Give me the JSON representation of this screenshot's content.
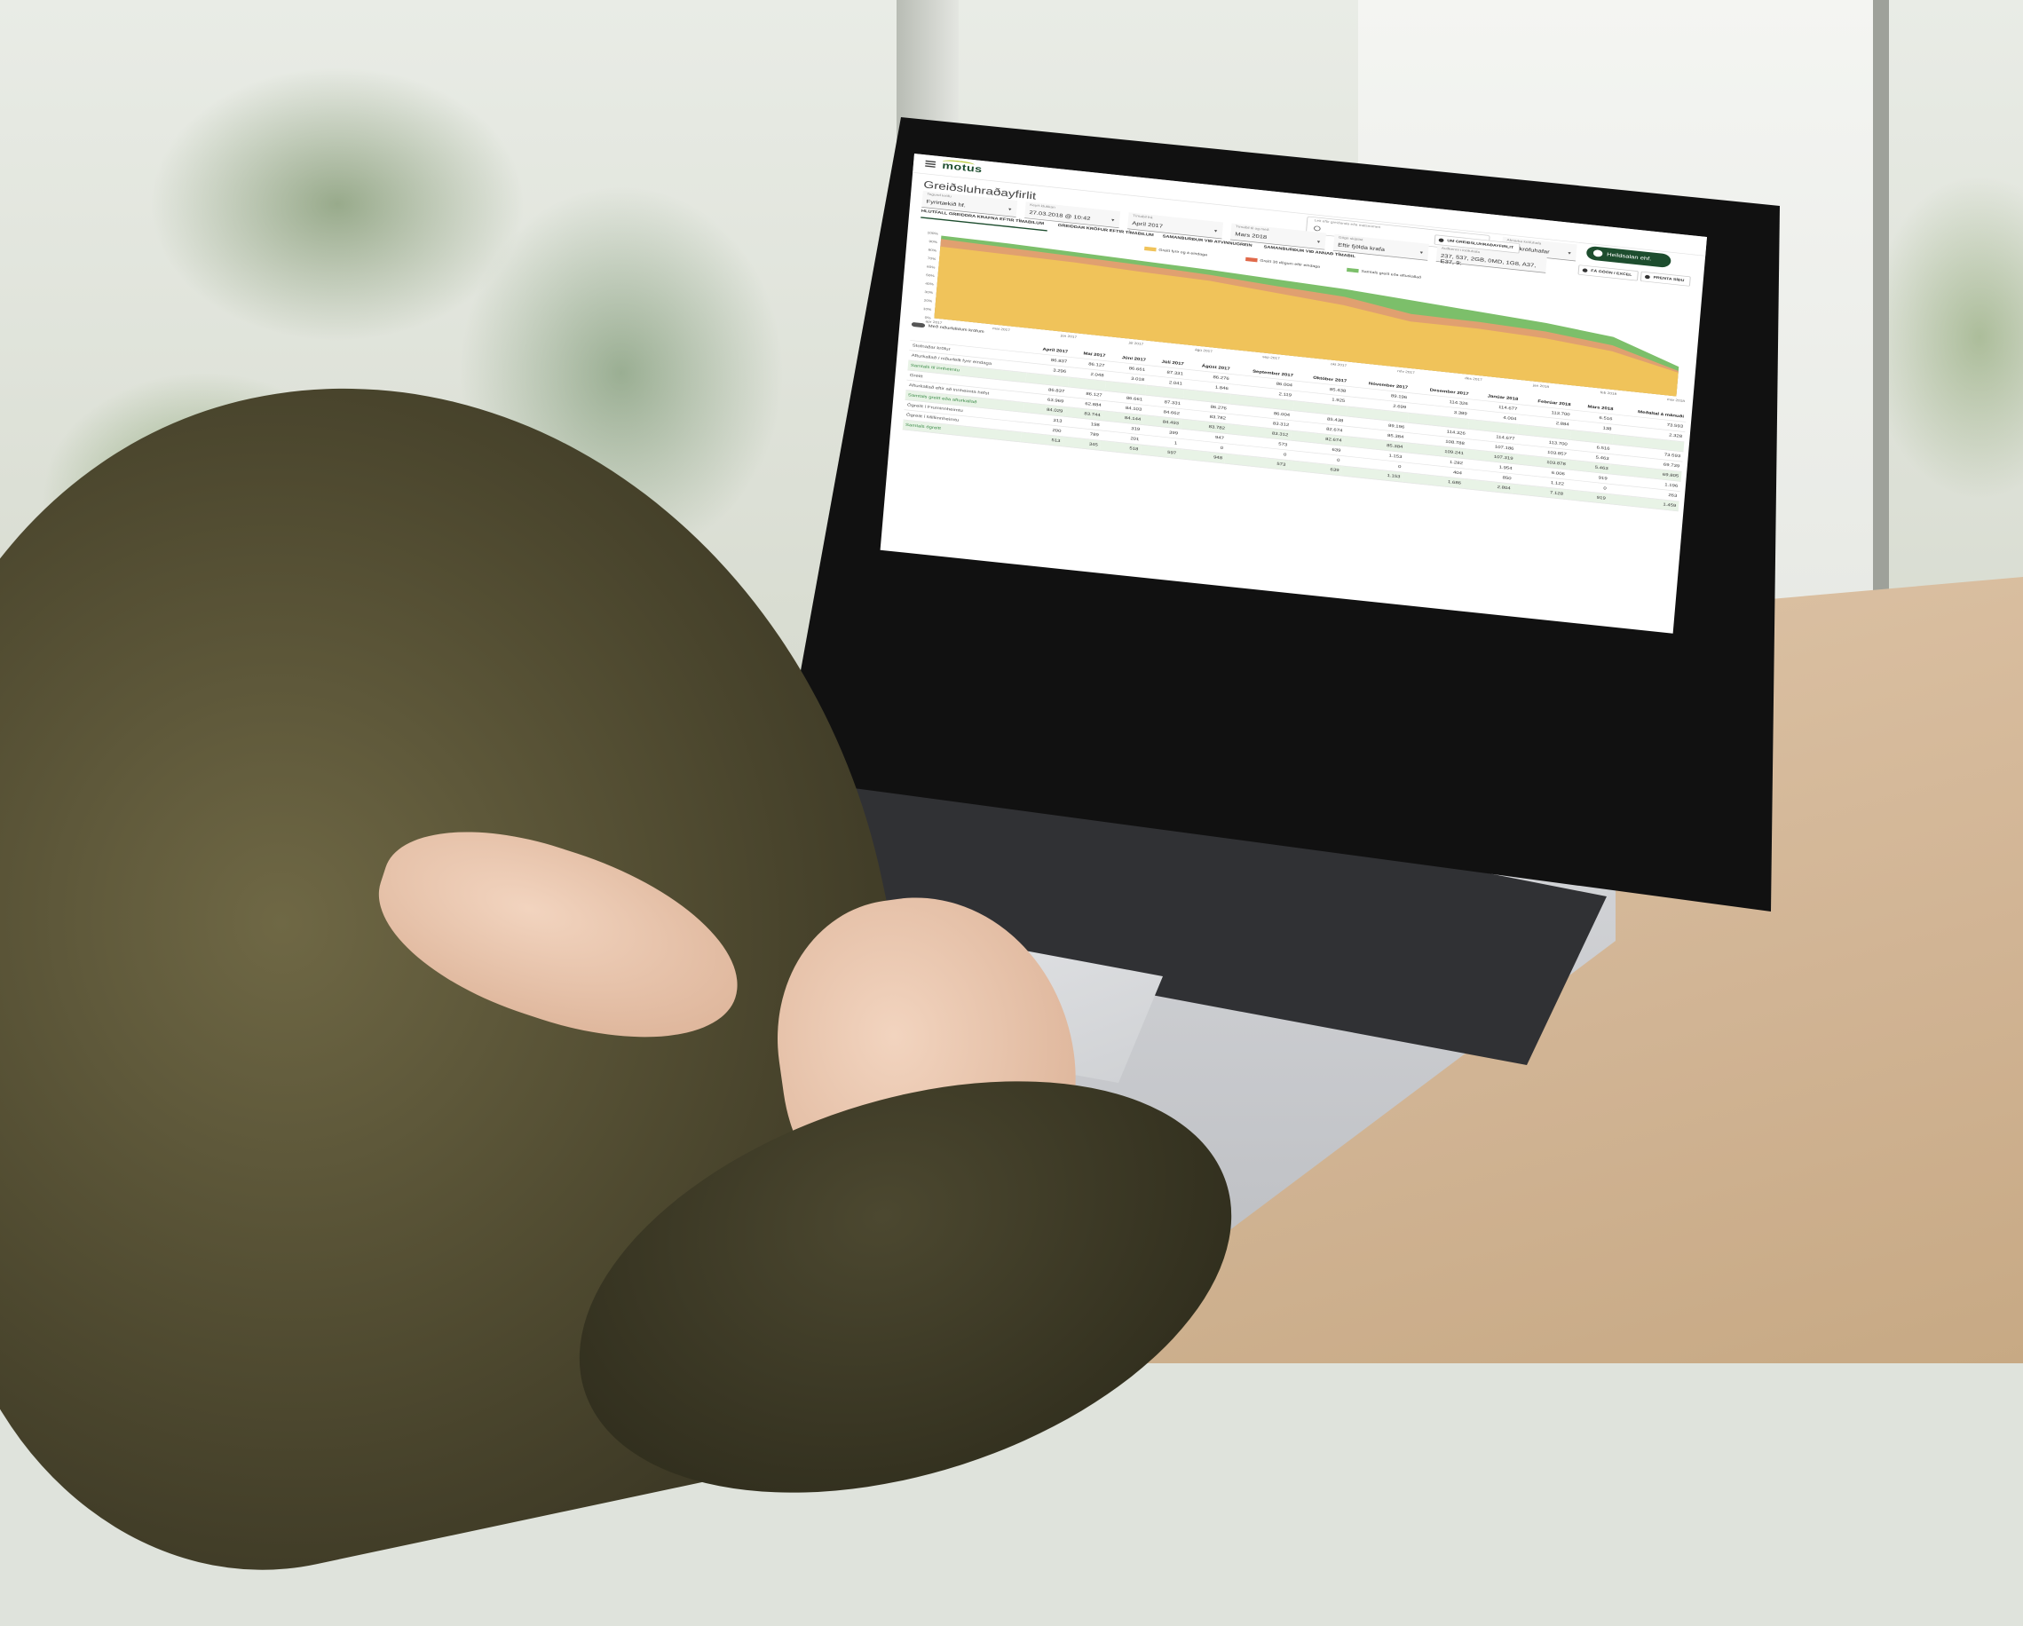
{
  "app": {
    "logo": "motus",
    "page_title": "Greiðsluhraðayfirlit",
    "search_placeholder": "Leit eftir greiðanda eða málsnúmeri",
    "user_button": "Heildsalan ehf."
  },
  "filters": [
    {
      "label": "Tegund kröfu",
      "value": "Fyrirtækið hf."
    },
    {
      "label": "Keyrt klukkan",
      "value": "27.03.2018 @ 10:42"
    },
    {
      "label": "Tímabil frá",
      "value": "Apríl 2017"
    },
    {
      "label": "Tímabil til og með",
      "value": "Mars 2018"
    },
    {
      "label": "Gögn skiptist",
      "value": "Eftir fjölda krafa"
    },
    {
      "label": "Auðkenni i kröfuhafa",
      "value": "237, 537, 2GB, 0MD, 1G8, A37, E37, 9:"
    },
    {
      "label": "Afmarka kröfuhafa",
      "value": "Allir kröfuhafar"
    }
  ],
  "actions": [
    "UM GREIÐSLUHRAÐAYFIRLIT",
    "FÁ GÖGN í EXCEL",
    "PRENTA SÍÐU"
  ],
  "tabs": [
    "HLUTFALL GREIDDRA KRAFNA EFTIR TÍMABILUM",
    "GREIDDAR KRÖFUR EFTIR TÍMABILUM",
    "SAMANBURÐUR VIÐ ATVINNUGREIN",
    "SAMANBURÐUR VIÐ ANNAÐ TÍMABIL"
  ],
  "chart_data": {
    "type": "area",
    "legend": [
      "Greitt fyrir og á eindaga",
      "Greitt 30 dögum eftir eindaga",
      "Samtals greitt eða afturkallað"
    ],
    "colors": {
      "paid_on_time": "#f0c35a",
      "paid_30": "#e0a070",
      "total": "#7cbf6a"
    },
    "x": [
      "apr 2017",
      "maí 2017",
      "jún 2017",
      "júl 2017",
      "ágú 2017",
      "sep 2017",
      "okt 2017",
      "nóv 2017",
      "des 2017",
      "jan 2018",
      "feb 2018",
      "mar 2018"
    ],
    "ylim": [
      0,
      100
    ],
    "yticks": [
      "0%",
      "10%",
      "20%",
      "30%",
      "40%",
      "50%",
      "60%",
      "70%",
      "80%",
      "90%",
      "100%"
    ]
  },
  "table": {
    "toggle_label": "Með niðurfelldum kröfum",
    "columns": [
      "",
      "Apríl 2017",
      "Maí 2017",
      "Júní 2017",
      "Júlí 2017",
      "Ágúst 2017",
      "September 2017",
      "Október 2017",
      "Nóvember 2017",
      "Desember 2017",
      "Janúar 2018",
      "Febrúar 2018",
      "Mars 2018",
      "Meðaltal á mánuði"
    ],
    "rows": [
      {
        "label": "Stofnaðar kröfur",
        "green": false,
        "cells": [
          "86.837",
          "86.127",
          "86.661",
          "87.331",
          "86.276",
          "86.004",
          "85.438",
          "89.196",
          "114.326",
          "114.677",
          "113.700",
          "6.516",
          "73.593"
        ]
      },
      {
        "label": "Afturkallað / niðurfellt fyrir eindaga",
        "green": false,
        "cells": [
          "3.296",
          "2.048",
          "3.018",
          "2.041",
          "1.846",
          "2.119",
          "1.925",
          "2.699",
          "3.389",
          "4.004",
          "2.884",
          "138",
          "2.328"
        ]
      },
      {
        "label": "Samtals til innheimtu",
        "green": true,
        "cells": [
          "",
          "",
          "",
          "",
          "",
          "",
          "",
          "",
          "",
          "",
          "",
          "",
          ""
        ]
      },
      {
        "label": "Greitt",
        "green": false,
        "cells": [
          "86.837",
          "86.127",
          "86.661",
          "87.331",
          "86.276",
          "86.004",
          "85.438",
          "89.196",
          "114.326",
          "114.677",
          "113.700",
          "6.516",
          "73.593"
        ]
      },
      {
        "label": "Afturkallað eftir að innheimta hefst",
        "green": false,
        "cells": [
          "63.969",
          "62.884",
          "84.103",
          "84.662",
          "83.782",
          "83.312",
          "82.674",
          "85.384",
          "108.788",
          "107.186",
          "103.857",
          "5.463",
          "69.739"
        ]
      },
      {
        "label": "Samtals greitt eða afturkallað",
        "green": true,
        "cells": [
          "84.029",
          "83.744",
          "84.144",
          "84.493",
          "83.782",
          "83.312",
          "82.674",
          "85.384",
          "109.241",
          "107.319",
          "103.878",
          "5.463",
          "69.805"
        ]
      },
      {
        "label": "Ógreitt í Fruminnheimtu",
        "green": false,
        "cells": [
          "313",
          "198",
          "319",
          "399",
          "947",
          "573",
          "639",
          "1.153",
          "1.282",
          "1.954",
          "6.006",
          "919",
          "1.196"
        ]
      },
      {
        "label": "Ógreitt í Milliinnheimtu",
        "green": false,
        "cells": [
          "200",
          "789",
          "201",
          "1",
          "0",
          "0",
          "0",
          "0",
          "404",
          "850",
          "1.122",
          "0",
          "263"
        ]
      },
      {
        "label": "Samtals ógreitt",
        "green": true,
        "cells": [
          "513",
          "345",
          "518",
          "597",
          "948",
          "573",
          "639",
          "1.153",
          "1.686",
          "2.804",
          "7.128",
          "919",
          "1.459"
        ]
      }
    ]
  }
}
